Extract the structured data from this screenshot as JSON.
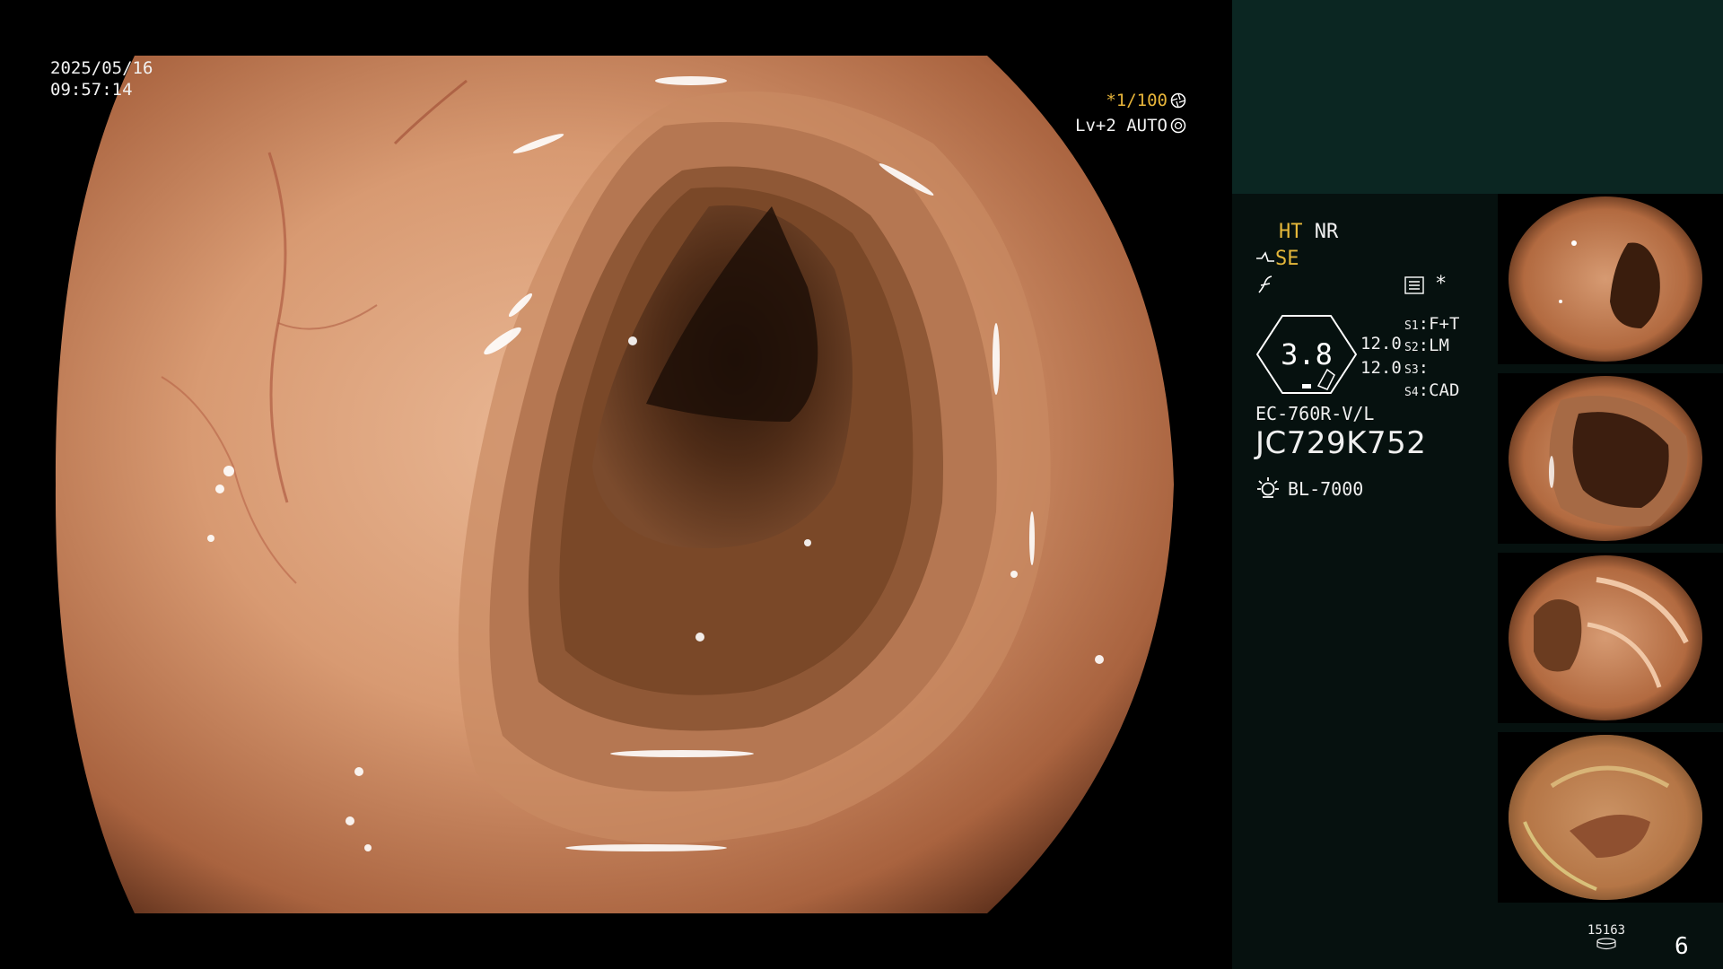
{
  "overlay": {
    "date": "2025/05/16",
    "time": "09:57:14",
    "shutter_mark": "*1/100",
    "level": "Lv+2",
    "mode": "AUTO"
  },
  "panel": {
    "ht": "HT",
    "nr": "NR",
    "se": "SE",
    "asterisk": "*",
    "gauge_value": "3.8",
    "value_a": "12.0",
    "value_b": "12.0",
    "switches": [
      {
        "key": "S1",
        "value": "F+T"
      },
      {
        "key": "S2",
        "value": "LM"
      },
      {
        "key": "S3",
        "value": ""
      },
      {
        "key": "S4",
        "value": "CAD"
      }
    ],
    "scope_model": "EC-760R-V/L",
    "serial": "JC729K752",
    "light_source": "BL-7000",
    "capture_count": "15163",
    "frame_number": "6",
    "icons": [
      "filter-icon",
      "function-icon",
      "menu-list-icon",
      "light-source-icon",
      "storage-icon",
      "shutter-icon",
      "auto-iris-icon"
    ],
    "colors": {
      "accent": "#e6b83a",
      "panel_top": "#0b2622",
      "panel_bg": "#06110f"
    }
  }
}
